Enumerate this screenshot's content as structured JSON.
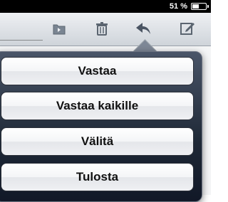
{
  "status_bar": {
    "battery_text": "51 %",
    "battery_level": 0.51
  },
  "toolbar": {
    "icons": [
      "folder-move-icon",
      "trash-icon",
      "reply-icon",
      "compose-icon"
    ]
  },
  "menu": {
    "items": [
      {
        "label": "Vastaa"
      },
      {
        "label": "Vastaa kaikille"
      },
      {
        "label": "Välitä"
      },
      {
        "label": "Tulosta"
      }
    ]
  },
  "colors": {
    "popover_dark": "#1f2937",
    "toolbar_light": "#eef0f3",
    "button_text": "#111111"
  }
}
